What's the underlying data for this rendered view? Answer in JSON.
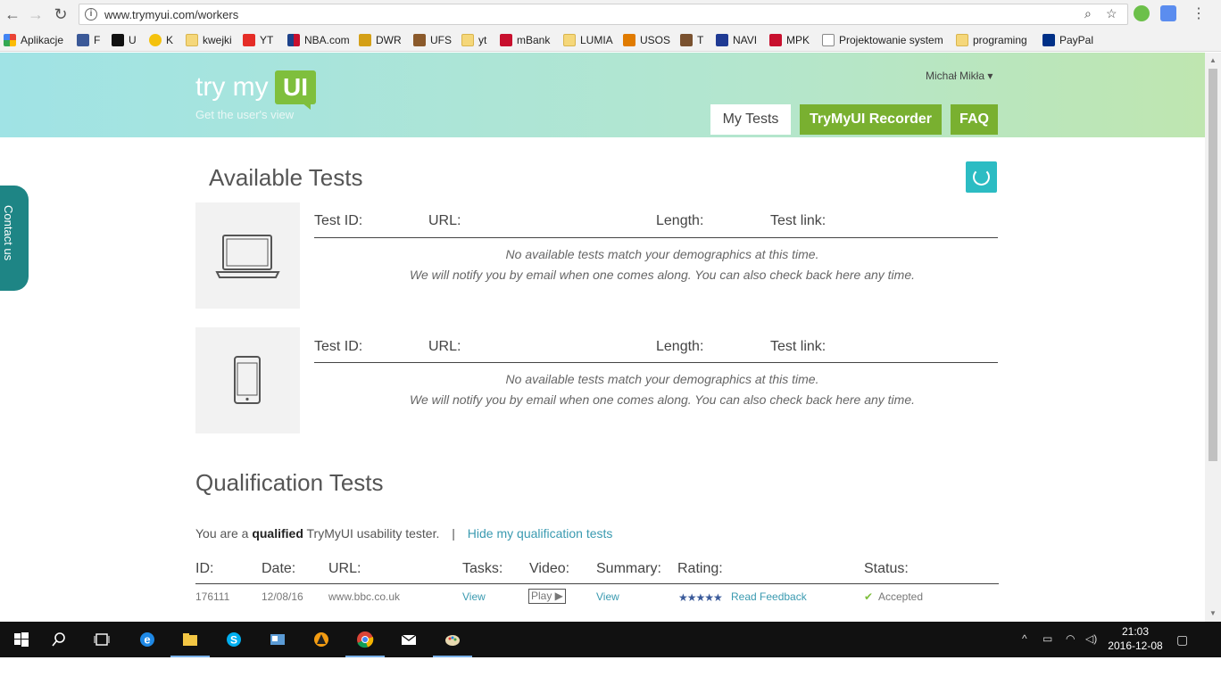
{
  "browser": {
    "url": "www.trymyui.com/workers",
    "bookmarks": [
      {
        "label": "Aplikacje",
        "color": "#4285f4"
      },
      {
        "label": "F",
        "color": "#3b5998"
      },
      {
        "label": "U",
        "color": "#111111"
      },
      {
        "label": "K",
        "color": "#f4c20d"
      },
      {
        "label": "kwejki",
        "color": "#f5d77a"
      },
      {
        "label": "YT",
        "color": "#e52d27"
      },
      {
        "label": "NBA.com",
        "color": "#c9082a"
      },
      {
        "label": "DWR",
        "color": "#d4a017"
      },
      {
        "label": "UFS",
        "color": "#8b5a2b"
      },
      {
        "label": "yt",
        "color": "#f5d77a"
      },
      {
        "label": "mBank",
        "color": "#c8102e"
      },
      {
        "label": "LUMIA",
        "color": "#f5d77a"
      },
      {
        "label": "USOS",
        "color": "#e07b00"
      },
      {
        "label": "T",
        "color": "#7a5230"
      },
      {
        "label": "NAVI",
        "color": "#1f3a93"
      },
      {
        "label": "MPK",
        "color": "#c8102e"
      },
      {
        "label": "Projektowanie system",
        "color": "#ffffff"
      },
      {
        "label": "programing",
        "color": "#f5d77a"
      },
      {
        "label": "PayPal",
        "color": "#003087"
      }
    ]
  },
  "header": {
    "logo_text": "try my",
    "logo_box": "UI",
    "tagline": "Get the user's view",
    "user_name": "Michał Mikła ▾",
    "nav": [
      "My Tests",
      "TryMyUI Recorder",
      "FAQ"
    ],
    "accent": "#79b030"
  },
  "contact_tab": "Contact us",
  "available": {
    "title": "Available Tests",
    "columns": [
      "Test ID:",
      "URL:",
      "Length:",
      "Test link:"
    ],
    "empty_line1": "No available tests match your demographics at this time.",
    "empty_line2": "We will notify you by email when one comes along. You can also check back here any time.",
    "devices": [
      "laptop-icon",
      "phone-icon"
    ]
  },
  "qualification": {
    "title": "Qualification Tests",
    "status_prefix": "You are a ",
    "status_bold": "qualified",
    "status_suffix": " TryMyUI usability tester.",
    "separator": "|",
    "hide_link": "Hide my qualification tests",
    "columns": [
      "ID:",
      "Date:",
      "URL:",
      "Tasks:",
      "Video:",
      "Summary:",
      "Rating:",
      "Status:"
    ],
    "rows": [
      {
        "id": "176111",
        "date": "12/08/16",
        "url": "www.bbc.co.uk",
        "tasks": "View",
        "video": "Play ▶",
        "summary": "View",
        "stars": "★★★★★",
        "rating_link": "Read Feedback",
        "status": "Accepted"
      }
    ]
  },
  "taskbar": {
    "time": "21:03",
    "date": "2016-12-08"
  }
}
